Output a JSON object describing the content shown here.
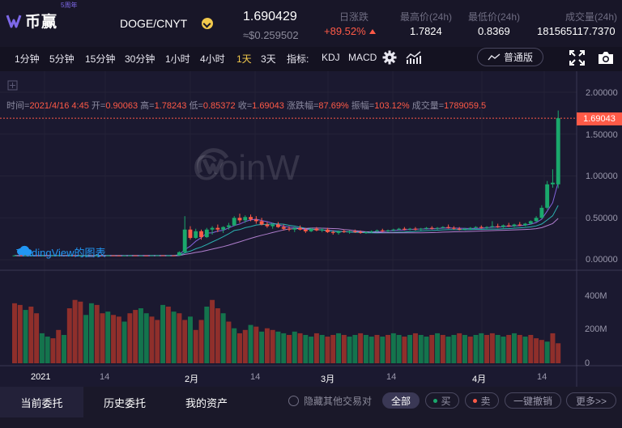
{
  "header": {
    "logo_text": "币赢",
    "logo_badge": "5周年",
    "pair": "DOGE/CNYT",
    "last_price": "1.690429",
    "last_price_usd": "≈$0.259502",
    "stats": [
      {
        "label": "日涨跌",
        "value": "+89.52%",
        "trend": "up"
      },
      {
        "label": "最高价(24h)",
        "value": "1.7824"
      },
      {
        "label": "最低价(24h)",
        "value": "0.8369"
      },
      {
        "label": "成交量(24h)",
        "value": "181565117.7370"
      }
    ]
  },
  "toolbar": {
    "timeframes": [
      "1分钟",
      "5分钟",
      "15分钟",
      "30分钟",
      "1小时",
      "4小时",
      "1天",
      "3天"
    ],
    "active_timeframe": "1天",
    "indicator_label": "指标:",
    "indicators": [
      "KDJ",
      "MACD"
    ],
    "mode_label": "普通版"
  },
  "chart": {
    "ohlc": {
      "time_label": "时间=",
      "time": "2021/4/16 4:45",
      "open_label": "开=",
      "open": "0.90063",
      "high_label": "高=",
      "high": "1.78243",
      "low_label": "低=",
      "low": "0.85372",
      "close_label": "收=",
      "close": "1.69043",
      "change_label": "涨跌幅=",
      "change": "87.69%",
      "amp_label": "振幅=",
      "amp": "103.12%",
      "vol_label": "成交量=",
      "vol": "1789059.5"
    },
    "tv_label": "TradingView的图表",
    "watermark": "CoinW",
    "current_price_tag": "1.69043"
  },
  "chart_data": {
    "type": "candlestick",
    "price_axis": {
      "ticks": [
        "2.00000",
        "1.50000",
        "1.00000",
        "0.50000",
        "0.00000"
      ],
      "ylim": [
        0,
        2
      ]
    },
    "volume_axis": {
      "ticks": [
        "400M",
        "200M",
        "0"
      ],
      "ylim": [
        0,
        500
      ]
    },
    "x_ticks": [
      "2021",
      "14",
      "2月",
      "14",
      "3月",
      "14",
      "4月",
      "14"
    ],
    "candles": [
      [
        0.05,
        0.052,
        0.049,
        0.051
      ],
      [
        0.051,
        0.052,
        0.05,
        0.05
      ],
      [
        0.05,
        0.052,
        0.049,
        0.051
      ],
      [
        0.051,
        0.053,
        0.05,
        0.052
      ],
      [
        0.052,
        0.053,
        0.05,
        0.05
      ],
      [
        0.05,
        0.051,
        0.049,
        0.051
      ],
      [
        0.051,
        0.052,
        0.05,
        0.05
      ],
      [
        0.05,
        0.052,
        0.049,
        0.052
      ],
      [
        0.052,
        0.054,
        0.051,
        0.053
      ],
      [
        0.053,
        0.054,
        0.051,
        0.051
      ],
      [
        0.051,
        0.053,
        0.05,
        0.052
      ],
      [
        0.052,
        0.053,
        0.05,
        0.05
      ],
      [
        0.05,
        0.052,
        0.049,
        0.051
      ],
      [
        0.051,
        0.053,
        0.05,
        0.052
      ],
      [
        0.052,
        0.053,
        0.05,
        0.05
      ],
      [
        0.05,
        0.052,
        0.049,
        0.051
      ],
      [
        0.051,
        0.052,
        0.049,
        0.05
      ],
      [
        0.05,
        0.052,
        0.049,
        0.052
      ],
      [
        0.052,
        0.053,
        0.05,
        0.051
      ],
      [
        0.051,
        0.052,
        0.049,
        0.05
      ],
      [
        0.05,
        0.052,
        0.049,
        0.051
      ],
      [
        0.051,
        0.053,
        0.05,
        0.052
      ],
      [
        0.052,
        0.053,
        0.05,
        0.05
      ],
      [
        0.05,
        0.052,
        0.049,
        0.051
      ],
      [
        0.051,
        0.052,
        0.049,
        0.05
      ],
      [
        0.05,
        0.052,
        0.049,
        0.052
      ],
      [
        0.052,
        0.054,
        0.051,
        0.053
      ],
      [
        0.053,
        0.054,
        0.051,
        0.051
      ],
      [
        0.051,
        0.053,
        0.05,
        0.052
      ],
      [
        0.052,
        0.053,
        0.05,
        0.05
      ],
      [
        0.05,
        0.1,
        0.049,
        0.09
      ],
      [
        0.09,
        0.52,
        0.09,
        0.36
      ],
      [
        0.36,
        0.4,
        0.24,
        0.26
      ],
      [
        0.26,
        0.37,
        0.25,
        0.34
      ],
      [
        0.34,
        0.36,
        0.24,
        0.27
      ],
      [
        0.27,
        0.38,
        0.26,
        0.36
      ],
      [
        0.36,
        0.4,
        0.3,
        0.38
      ],
      [
        0.38,
        0.42,
        0.33,
        0.36
      ],
      [
        0.36,
        0.4,
        0.32,
        0.39
      ],
      [
        0.39,
        0.44,
        0.36,
        0.41
      ],
      [
        0.41,
        0.52,
        0.4,
        0.5
      ],
      [
        0.5,
        0.55,
        0.44,
        0.47
      ],
      [
        0.47,
        0.53,
        0.44,
        0.51
      ],
      [
        0.51,
        0.54,
        0.46,
        0.48
      ],
      [
        0.48,
        0.52,
        0.43,
        0.46
      ],
      [
        0.46,
        0.5,
        0.41,
        0.42
      ],
      [
        0.42,
        0.45,
        0.38,
        0.4
      ],
      [
        0.4,
        0.44,
        0.37,
        0.42
      ],
      [
        0.42,
        0.45,
        0.38,
        0.39
      ],
      [
        0.39,
        0.42,
        0.35,
        0.37
      ],
      [
        0.37,
        0.4,
        0.34,
        0.36
      ],
      [
        0.36,
        0.39,
        0.33,
        0.38
      ],
      [
        0.38,
        0.41,
        0.35,
        0.36
      ],
      [
        0.36,
        0.38,
        0.32,
        0.34
      ],
      [
        0.34,
        0.38,
        0.33,
        0.37
      ],
      [
        0.37,
        0.39,
        0.34,
        0.35
      ],
      [
        0.35,
        0.38,
        0.33,
        0.36
      ],
      [
        0.36,
        0.38,
        0.32,
        0.33
      ],
      [
        0.33,
        0.35,
        0.3,
        0.32
      ],
      [
        0.32,
        0.35,
        0.3,
        0.34
      ],
      [
        0.34,
        0.36,
        0.32,
        0.33
      ],
      [
        0.33,
        0.35,
        0.31,
        0.34
      ],
      [
        0.34,
        0.36,
        0.32,
        0.33
      ],
      [
        0.33,
        0.35,
        0.31,
        0.32
      ],
      [
        0.32,
        0.34,
        0.31,
        0.33
      ],
      [
        0.33,
        0.35,
        0.32,
        0.34
      ],
      [
        0.34,
        0.36,
        0.33,
        0.35
      ],
      [
        0.35,
        0.37,
        0.33,
        0.34
      ],
      [
        0.34,
        0.36,
        0.33,
        0.35
      ],
      [
        0.35,
        0.37,
        0.34,
        0.36
      ],
      [
        0.36,
        0.38,
        0.35,
        0.37
      ],
      [
        0.37,
        0.39,
        0.35,
        0.36
      ],
      [
        0.36,
        0.38,
        0.35,
        0.37
      ],
      [
        0.37,
        0.39,
        0.35,
        0.36
      ],
      [
        0.36,
        0.38,
        0.35,
        0.37
      ],
      [
        0.37,
        0.39,
        0.36,
        0.38
      ],
      [
        0.38,
        0.4,
        0.36,
        0.37
      ],
      [
        0.37,
        0.39,
        0.36,
        0.38
      ],
      [
        0.38,
        0.4,
        0.37,
        0.39
      ],
      [
        0.39,
        0.42,
        0.37,
        0.38
      ],
      [
        0.38,
        0.4,
        0.36,
        0.37
      ],
      [
        0.37,
        0.39,
        0.35,
        0.36
      ],
      [
        0.36,
        0.38,
        0.35,
        0.37
      ],
      [
        0.37,
        0.39,
        0.36,
        0.38
      ],
      [
        0.38,
        0.4,
        0.37,
        0.39
      ],
      [
        0.39,
        0.41,
        0.37,
        0.38
      ],
      [
        0.38,
        0.4,
        0.37,
        0.39
      ],
      [
        0.39,
        0.46,
        0.38,
        0.4
      ],
      [
        0.4,
        0.43,
        0.38,
        0.39
      ],
      [
        0.39,
        0.42,
        0.38,
        0.41
      ],
      [
        0.41,
        0.44,
        0.39,
        0.4
      ],
      [
        0.4,
        0.43,
        0.39,
        0.42
      ],
      [
        0.42,
        0.45,
        0.4,
        0.41
      ],
      [
        0.41,
        0.44,
        0.4,
        0.43
      ],
      [
        0.43,
        0.47,
        0.42,
        0.46
      ],
      [
        0.46,
        0.52,
        0.45,
        0.5
      ],
      [
        0.5,
        0.65,
        0.49,
        0.62
      ],
      [
        0.62,
        0.94,
        0.6,
        0.9
      ],
      [
        0.9,
        1.08,
        0.86,
        0.92
      ],
      [
        0.9,
        1.782,
        0.854,
        1.69
      ]
    ],
    "volume": [
      360,
      350,
      320,
      340,
      300,
      180,
      160,
      150,
      200,
      170,
      330,
      380,
      370,
      290,
      360,
      350,
      300,
      310,
      290,
      280,
      250,
      300,
      320,
      330,
      300,
      280,
      260,
      350,
      340,
      310,
      300,
      260,
      280,
      200,
      260,
      340,
      380,
      330,
      300,
      250,
      210,
      180,
      200,
      230,
      220,
      190,
      210,
      200,
      190,
      180,
      170,
      190,
      180,
      170,
      160,
      180,
      170,
      160,
      170,
      180,
      170,
      160,
      170,
      180,
      170,
      160,
      170,
      160,
      170,
      180,
      170,
      160,
      170,
      180,
      170,
      160,
      170,
      180,
      170,
      160,
      170,
      180,
      170,
      160,
      170,
      180,
      170,
      180,
      170,
      160,
      170,
      180,
      170,
      160,
      170,
      150,
      140,
      130,
      180,
      120
    ],
    "volume_color": [
      "r",
      "r",
      "g",
      "r",
      "r",
      "g",
      "g",
      "r",
      "r",
      "g",
      "r",
      "r",
      "r",
      "g",
      "g",
      "r",
      "r",
      "g",
      "r",
      "r",
      "g",
      "r",
      "r",
      "g",
      "g",
      "r",
      "r",
      "g",
      "r",
      "g",
      "r",
      "r",
      "g",
      "r",
      "r",
      "g",
      "r",
      "r",
      "g",
      "r",
      "g",
      "r",
      "r",
      "g",
      "r",
      "g",
      "r",
      "r",
      "g",
      "g",
      "r",
      "g",
      "r",
      "g",
      "g",
      "r",
      "g",
      "r",
      "r",
      "g",
      "r",
      "g",
      "g",
      "r",
      "g",
      "g",
      "r",
      "g",
      "r",
      "g",
      "g",
      "r",
      "g",
      "r",
      "g",
      "g",
      "r",
      "g",
      "r",
      "g",
      "g",
      "r",
      "g",
      "r",
      "g",
      "g",
      "r",
      "r",
      "g",
      "g",
      "r",
      "g",
      "r",
      "g",
      "r",
      "r",
      "r",
      "g",
      "r",
      "r"
    ]
  },
  "bottom": {
    "tabs": [
      "当前委托",
      "历史委托",
      "我的资产"
    ],
    "hide_other_pairs": "隐藏其他交易对",
    "all_label": "全部",
    "buy_label": "买",
    "sell_label": "卖",
    "cancel_all": "一键撤销",
    "more": "更多>>"
  },
  "colors": {
    "up": "#ff5a47",
    "down": "#1aa86c",
    "accent": "#f2c94c",
    "ma1": "#8e6cf0",
    "ma2": "#2dc3c0"
  }
}
